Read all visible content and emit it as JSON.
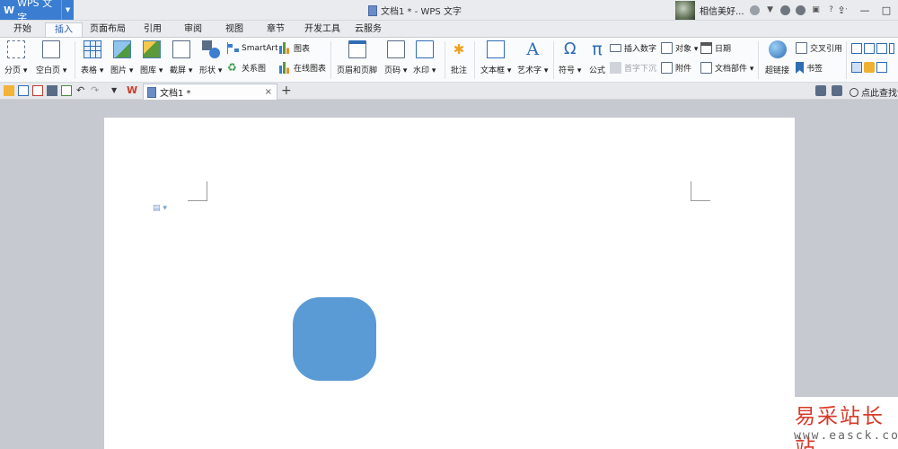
{
  "app": {
    "name": "WPS 文字",
    "window_title": "文档1 * - WPS 文字"
  },
  "user": {
    "name": "相信美好..."
  },
  "window_controls": {
    "help": "?",
    "minimize": "—",
    "restore": "□",
    "more": "·"
  },
  "tabs": [
    {
      "label": "开始"
    },
    {
      "label": "插入"
    },
    {
      "label": "页面布局"
    },
    {
      "label": "引用"
    },
    {
      "label": "审阅"
    },
    {
      "label": "视图"
    },
    {
      "label": "章节"
    },
    {
      "label": "开发工具"
    },
    {
      "label": "云服务"
    }
  ],
  "active_tab": "插入",
  "ribbon": {
    "page_break": "分页",
    "blank_page": "空白页",
    "table": "表格",
    "picture": "图片",
    "gallery": "图库",
    "screenshot": "截屏",
    "shapes": "形状",
    "smartart": "SmartArt",
    "chart": "图表",
    "relation": "关系图",
    "online_chart": "在线图表",
    "header_footer": "页眉和页脚",
    "page_number": "页码",
    "watermark": "水印",
    "comment": "批注",
    "textbox": "文本框",
    "wordart": "艺术字",
    "symbol": "符号",
    "formula": "公式",
    "insert_number": "插入数字",
    "drop_cap": "首字下沉",
    "object": "对象",
    "attachment": "附件",
    "date": "日期",
    "doc_parts": "文档部件",
    "hyperlink": "超链接",
    "cross_ref": "交叉引用",
    "bookmark": "书签"
  },
  "document_tab": {
    "title": "文档1 *",
    "close": "×",
    "add": "+"
  },
  "find": {
    "label": "点此查找命"
  },
  "canvas": {
    "shape_color": "#5b9bd5",
    "page_color": "#ffffff",
    "workspace_color": "#c6c9cf"
  },
  "watermark": {
    "title": "易采站长站",
    "url": "www.easck.com"
  },
  "colors": {
    "accent": "#3a7dd1",
    "title_bar": "#e9ebee"
  }
}
